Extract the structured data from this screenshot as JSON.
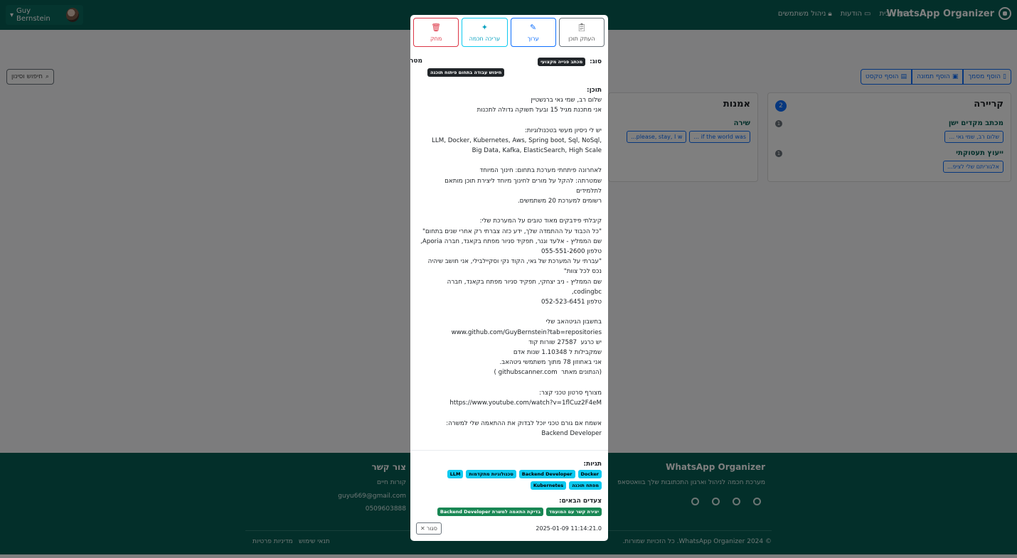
{
  "navbar": {
    "brand": "WhatsApp Organizer",
    "links": [
      "דף הבית",
      "הודעות",
      "ניהול משתמשים"
    ],
    "user": "Guy Bernstein"
  },
  "toolbar": {
    "add_document": "הוסף מסמך",
    "add_image": "הוסף תמונה",
    "add_text": "הוסף טקסט",
    "search_filter": "חיפוש וסינון"
  },
  "cards": [
    {
      "title": "קריירה",
      "count": "2",
      "sections": [
        {
          "title": "מכתב מקדים ישן",
          "count": "1",
          "chips": [
            "שלום רב, שמי גאי ..."
          ]
        },
        {
          "title": "ייעוץ תעסוקתי",
          "count": "1",
          "chips": [
            "אלגוריתם שלי לציפ..."
          ]
        }
      ]
    },
    {
      "title": "אמנות",
      "sections": [
        {
          "title": "שירה",
          "chips": [
            "if the world was ...",
            "please, stay, I w..."
          ]
        }
      ]
    }
  ],
  "footer": {
    "brand": "WhatsApp Organizer",
    "brand_desc": "מערכת חכמה לניהול וארגון התכתובות שלך בוואטסאפ",
    "contact_title": "צור קשר",
    "contact_lines": [
      "קורות חיים",
      "guyu669@gmail.com",
      "0509603888"
    ],
    "copyright": "© 2024 WhatsApp Organizer. כל הזכויות שמורות.",
    "terms": "תנאי שימוש",
    "privacy": "מדיניות פרטיות"
  },
  "modal": {
    "actions": {
      "copy": "העתק תוכן",
      "edit": "ערוך",
      "smart_edit": "עריכה חכמה",
      "delete": "מחק"
    },
    "type_label": "סוג:",
    "type_value": "מכתב פנייה מקצועי",
    "goal_label": "מטרה:",
    "goal_value": "חיפוש עבודה בתחום פיתוח תוכנה",
    "content_label": "תוכן:",
    "content": "שלום רב, שמי גאי ברנשטיין\nאני מתכנת מגיל 15 ובעל תשוקה גדולה לתכנות\n\nיש לי ניסיון מעשי בטכנולוגיות:\n,LLM, Docker, Kubernetes, Aws, Spring boot, Sql, NoSql\nBig Data, Kafka, ElasticSearch, High Scale\n\nלאחרונה פיתחתי מערכת בתחום: חינוך המיוחד\nשמטרתה: להקל על מורים לחינוך מיוחד ליצירת תוכן מותאם לתלמידים\nרשומים למערכת 20 משתמשים.\n\nקיבלתי פידבקים מאוד טובים על המערכת שלי:\n\"כל הכבוד על ההתמדה שלך, ידע כזה צברתי רק אחרי שנים בתחום\"\nשם הממליץ - אלעד וגנר, תפקיד סניור מפתח בקאנד, חברה Aporia,\nטלפון 055-551-2600\n\"עברתי על המערכת של גאי, הקוד נקי וסקיילבילי, אני חושב שיהיה נכס לכל צוות\"\nשם הממליץ - ניב יצחקי, תפקיד סניור מפתח בקאנד, חברה codingbc,\nטלפון 052-523-6451\n\nבחשבון הגיטהאב שלי\nwww.github.com/GuyBernstein?tab=repositories\nיש כרגע  27587 שורות קוד\nשמקבילות ל 1.10348 שנות אדם\nאני באחוזון 78 מתוך משתמשי גיטהאב.\n(הנתונים מאתר  githubscanner.com )\n\nמצורף סרטון טכני קצר:\nhttps://www.youtube.com/watch?v=1flCuz2F4eM\n\nאשמח אם גורם טכני יוכל לבדוק את ההתאמה שלי למשרה:\nBackend Developer\n\nתודה רבה מראש,\nגאי ברנשטיין.",
    "tags_label": "תגיות:",
    "tags": [
      "Docker",
      "Backend Developer",
      "טכנולוגיות מתקדמות",
      "LLM",
      "מפתח תוכנה",
      "Kubernetes"
    ],
    "next_steps_label": "צעדים הבאים:",
    "next_steps": [
      "יצירת קשר עם המועמד",
      "בדיקת התאמה למשרת Backend Developer"
    ],
    "timestamp": "2025-01-09 11:14:21.0",
    "close": "סגור"
  }
}
